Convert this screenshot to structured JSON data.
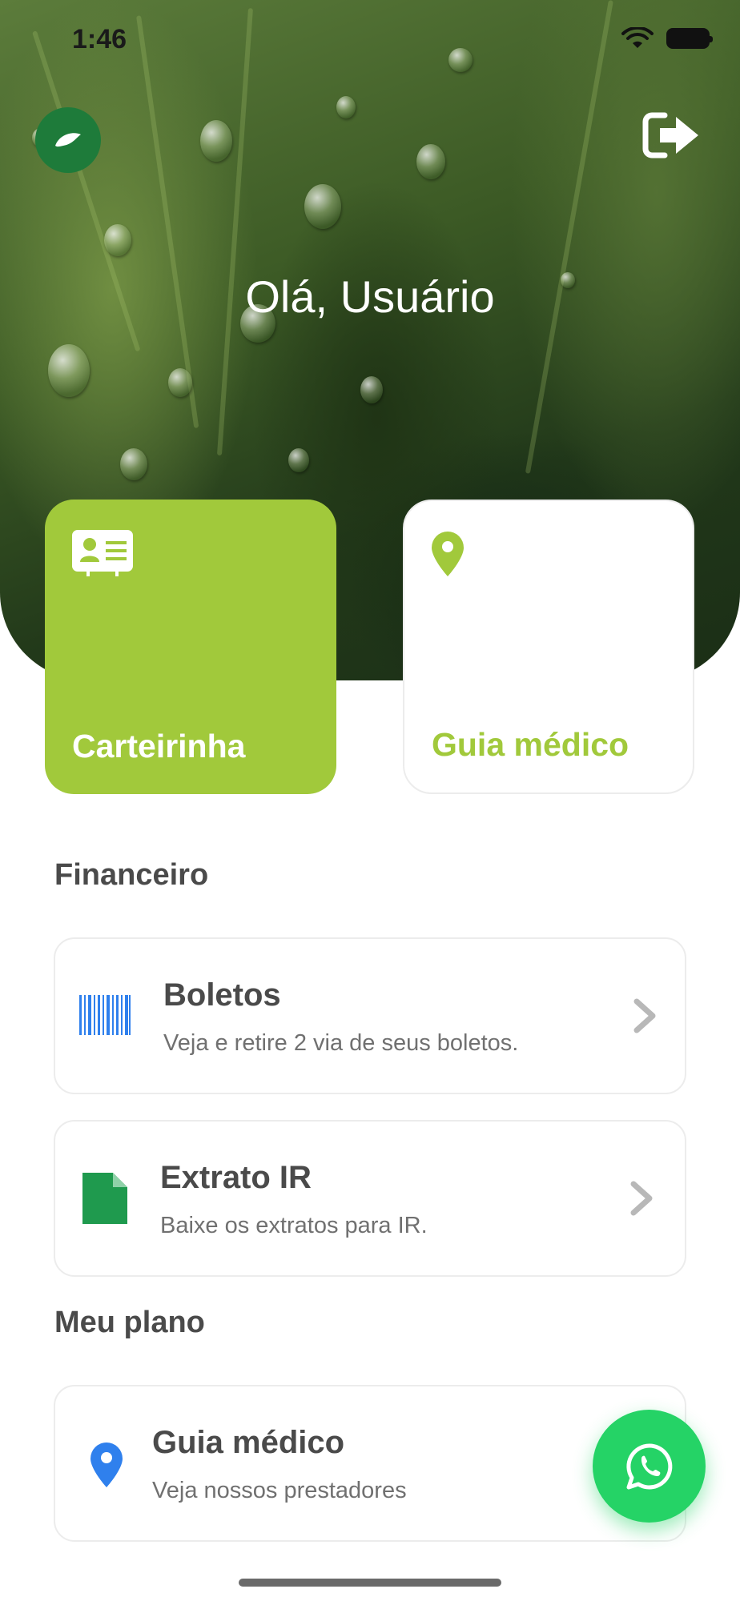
{
  "status_bar": {
    "time": "1:46"
  },
  "header": {
    "greeting": "Olá, Usuário"
  },
  "cards": [
    {
      "label": "Carteirinha",
      "icon": "id-card-icon",
      "color": "#a1c93b"
    },
    {
      "label": "Guia médico",
      "icon": "map-pin-icon",
      "color": "#a1c93b"
    }
  ],
  "financeiro": {
    "title": "Financeiro",
    "items": [
      {
        "title": "Boletos",
        "subtitle": "Veja e retire 2 via de seus boletos.",
        "icon": "barcode-icon"
      },
      {
        "title": "Extrato IR",
        "subtitle": "Baixe os extratos para IR.",
        "icon": "document-icon"
      }
    ]
  },
  "meu_plano": {
    "title": "Meu plano",
    "items": [
      {
        "title": "Guia médico",
        "subtitle": "Veja nossos prestadores",
        "icon": "location-pin-icon"
      }
    ]
  },
  "colors": {
    "accent": "#a1c93b",
    "brand_dark": "#1e7b3a",
    "whatsapp": "#25d366",
    "doc_green": "#1f9a4e",
    "pin_blue": "#2f80ed"
  }
}
